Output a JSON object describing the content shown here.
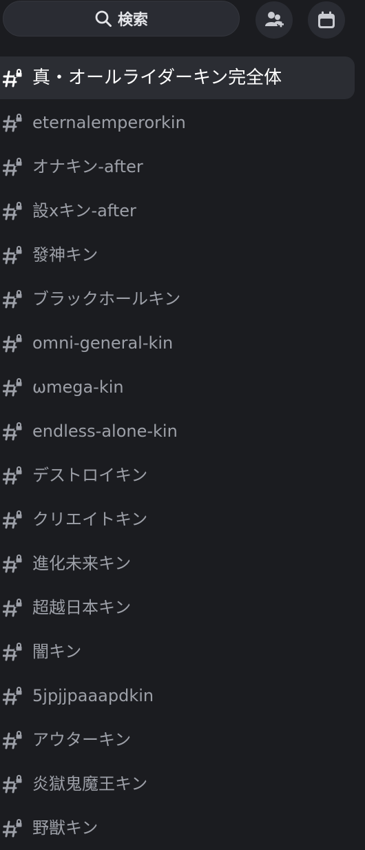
{
  "search": {
    "label": "検索",
    "icon": "search-icon"
  },
  "toolbar": {
    "invite_icon": "add-member-icon",
    "events_icon": "calendar-icon"
  },
  "channels": [
    {
      "name": "真・オールライダーキン完全体",
      "active": true,
      "icon": "locked-hash-icon"
    },
    {
      "name": "eternalemperorkin",
      "active": false,
      "icon": "locked-hash-icon"
    },
    {
      "name": "オナキン-after",
      "active": false,
      "icon": "locked-hash-icon"
    },
    {
      "name": "設xキン-after",
      "active": false,
      "icon": "locked-hash-icon"
    },
    {
      "name": "發神キン",
      "active": false,
      "icon": "locked-hash-icon"
    },
    {
      "name": "ブラックホールキン",
      "active": false,
      "icon": "locked-hash-icon"
    },
    {
      "name": "omni-general-kin",
      "active": false,
      "icon": "locked-hash-icon"
    },
    {
      "name": "ωmega-kin",
      "active": false,
      "icon": "locked-hash-icon"
    },
    {
      "name": "endless-alone-kin",
      "active": false,
      "icon": "locked-hash-icon"
    },
    {
      "name": "デストロイキン",
      "active": false,
      "icon": "locked-hash-icon"
    },
    {
      "name": "クリエイトキン",
      "active": false,
      "icon": "locked-hash-icon"
    },
    {
      "name": "進化未来キン",
      "active": false,
      "icon": "locked-hash-icon"
    },
    {
      "name": "超越日本キン",
      "active": false,
      "icon": "locked-hash-icon"
    },
    {
      "name": "闇キン",
      "active": false,
      "icon": "locked-hash-icon"
    },
    {
      "name": "5jpjjpaaapdkin",
      "active": false,
      "icon": "locked-hash-icon"
    },
    {
      "name": "アウターキン",
      "active": false,
      "icon": "locked-hash-icon"
    },
    {
      "name": "炎獄鬼魔王キン",
      "active": false,
      "icon": "locked-hash-icon"
    },
    {
      "name": "野獣キン",
      "active": false,
      "icon": "locked-hash-icon"
    }
  ],
  "colors": {
    "background": "#1b1c20",
    "surface": "#2a2c33",
    "active_row": "#2b2d33",
    "text_active": "#ffffff",
    "text_muted": "#9da0a8"
  }
}
